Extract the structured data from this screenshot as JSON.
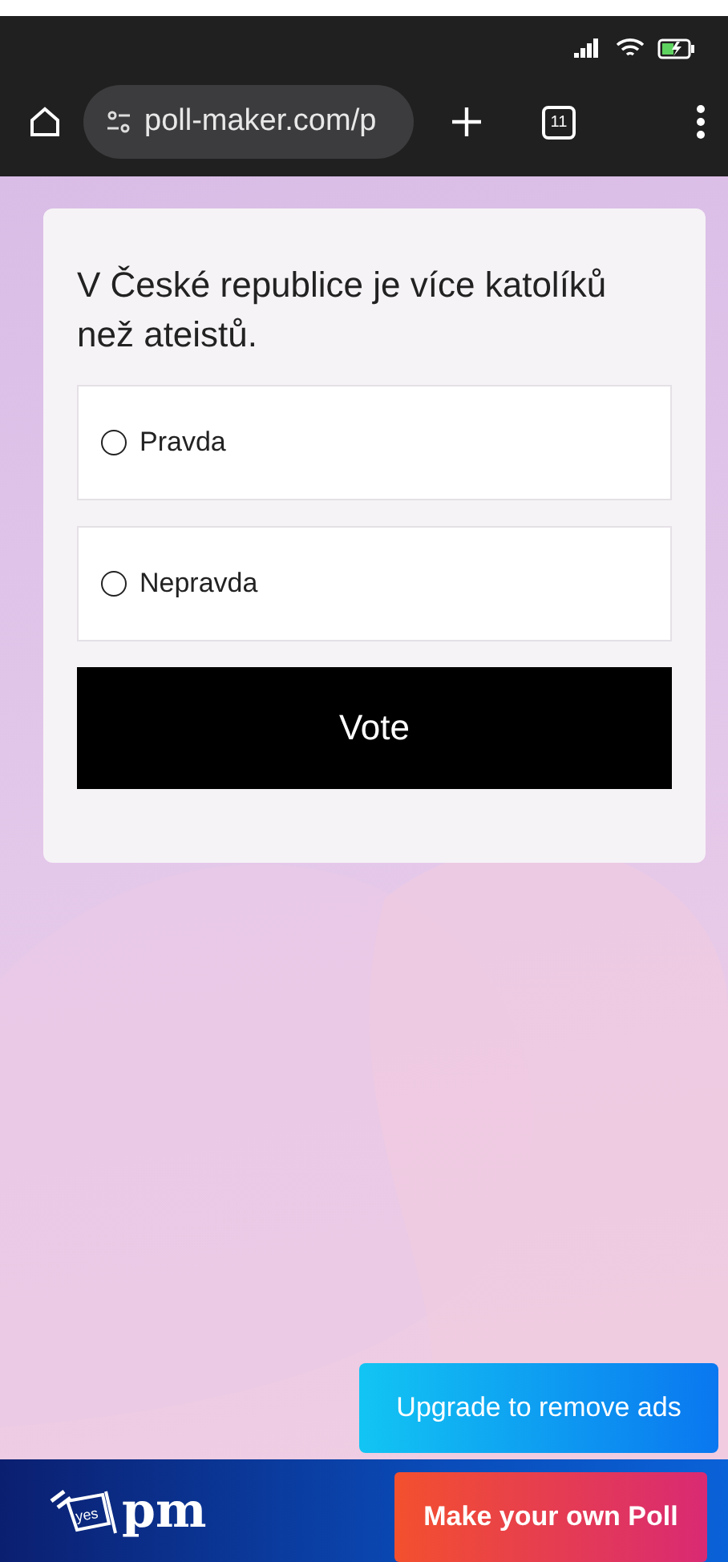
{
  "browser": {
    "url": "poll-maker.com/p",
    "tab_count": "11"
  },
  "poll": {
    "question": "V České republice je více katolíků než ateistů.",
    "options": [
      {
        "label": "Pravda",
        "selected": false
      },
      {
        "label": "Nepravda",
        "selected": false
      }
    ],
    "vote_button": "Vote"
  },
  "upgrade_button": "Upgrade to remove ads",
  "footer": {
    "logo_badge": "yes",
    "logo_text": "pm",
    "cta_button": "Make your own Poll"
  }
}
